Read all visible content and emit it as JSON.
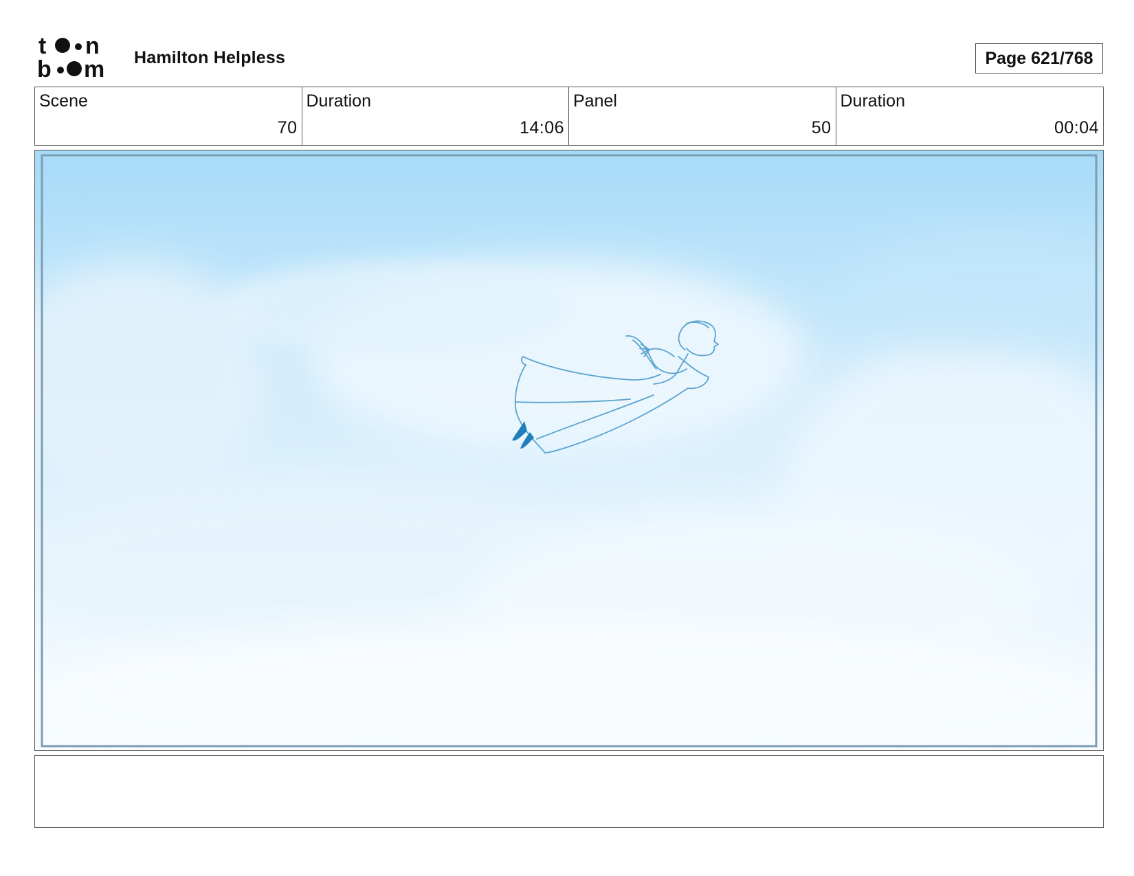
{
  "header": {
    "logo": {
      "line1": "toon",
      "line2": "boom"
    },
    "project_title": "Hamilton Helpless",
    "page_label": "Page 621/768"
  },
  "info": [
    {
      "label": "Scene",
      "value": "70"
    },
    {
      "label": "Duration",
      "value": "14:06"
    },
    {
      "label": "Panel",
      "value": "50"
    },
    {
      "label": "Duration",
      "value": "00:04"
    }
  ],
  "panel": {
    "description": "",
    "colors": {
      "sky_top": "#a6dbf8",
      "sky_bottom": "#f7fbfe",
      "sketch": "#5aa3cf",
      "shoes": "#1f7fba"
    }
  },
  "notes": {
    "text": ""
  }
}
